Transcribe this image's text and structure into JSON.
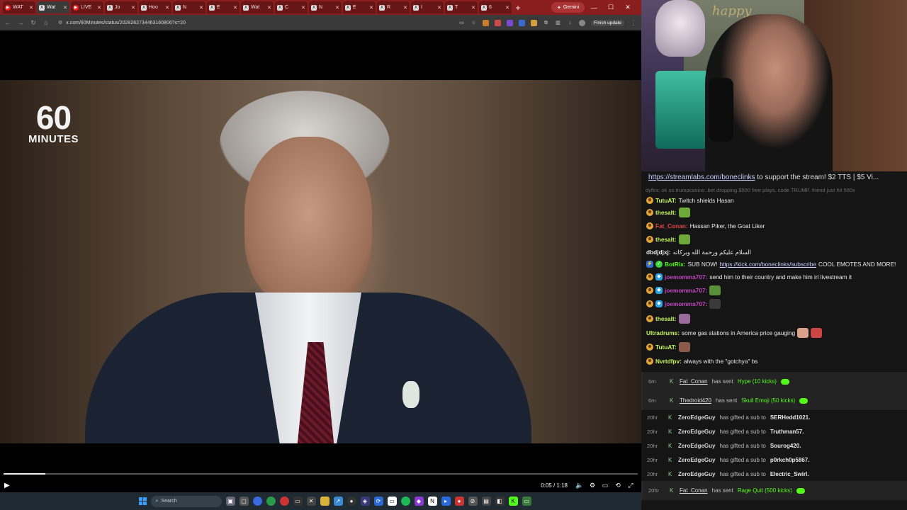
{
  "browser": {
    "tabs": [
      {
        "label": "WAT",
        "icon": "youtube-icon",
        "active": false
      },
      {
        "label": "Wat",
        "icon": "x-icon",
        "active": true
      },
      {
        "label": "LIVE",
        "icon": "youtube-icon",
        "active": false
      },
      {
        "label": "Jo",
        "icon": "x-icon",
        "active": false
      },
      {
        "label": "Hoo",
        "icon": "x-icon",
        "active": false
      },
      {
        "label": "N",
        "icon": "x-icon",
        "active": false
      },
      {
        "label": "E",
        "icon": "x-icon",
        "active": false
      },
      {
        "label": "Wat",
        "icon": "x-icon",
        "active": false
      },
      {
        "label": "C",
        "icon": "x-icon",
        "active": false
      },
      {
        "label": "N",
        "icon": "x-icon",
        "active": false
      },
      {
        "label": "E",
        "icon": "x-icon",
        "active": false
      },
      {
        "label": "R",
        "icon": "x-icon",
        "active": false
      },
      {
        "label": "I",
        "icon": "x-icon",
        "active": false
      },
      {
        "label": "T",
        "icon": "x-icon",
        "active": false
      },
      {
        "label": "6",
        "icon": "x-icon",
        "active": false
      }
    ],
    "gemini_label": "Gemini",
    "url": "x.com/60Minutes/status/2028262734463160806?s=20",
    "finish_update": "Finish update"
  },
  "video": {
    "logo_number": "60",
    "logo_word": "MINUTES",
    "time": "0:05 / 1:18",
    "progress": 0.066
  },
  "taskbar": {
    "search_label": "Search"
  },
  "webcam": {
    "sign_text": "happy"
  },
  "chat": {
    "pinned_link": "https://streamlabs.com/boneclinks",
    "pinned_text": " to support the stream! $2 TTS | $5 Vi...",
    "faded": "dyftrx: ok so trumpcasino .bet dropping $500 free plays, code TRUMP. friend just hit 500x",
    "messages": [
      {
        "badges": [
          "smile"
        ],
        "user": "TutuAT:",
        "color": "#c6f55a",
        "text": "Twitch shields Hasan",
        "emotes": []
      },
      {
        "badges": [
          "smile"
        ],
        "user": "thesalt:",
        "color": "#c6f55a",
        "text": "",
        "emotes": [
          "#6fa83a"
        ]
      },
      {
        "badges": [
          "smile"
        ],
        "user": "Fat_Conan:",
        "color": "#e04646",
        "text": "Hassan Piker, the Goat Liker",
        "emotes": []
      },
      {
        "badges": [
          "smile"
        ],
        "user": "thesalt:",
        "color": "#c6f55a",
        "text": "",
        "emotes": [
          "#6fa83a"
        ]
      },
      {
        "badges": [],
        "user": "dbdjdjxj:",
        "color": "#e8e8e8",
        "text": "السلام عليكم ورحمة الله وبركاته",
        "emotes": []
      },
      {
        "badges": [
          "bot",
          "check"
        ],
        "user": "BotRix:",
        "color": "#53fc18",
        "text": "SUB NOW! ",
        "link": "https://kick.com/boneclinks/subscribe",
        "after": " COOL EMOTES AND MORE!",
        "emotes": []
      },
      {
        "badges": [
          "smile",
          "sub"
        ],
        "user": "joemomma707:",
        "color": "#c243c2",
        "text": "send him to their country and make him irl livestream it",
        "emotes": []
      },
      {
        "badges": [
          "smile",
          "sub"
        ],
        "user": "joemomma707:",
        "color": "#c243c2",
        "text": "",
        "emotes": [
          "#5a8f3a"
        ]
      },
      {
        "badges": [
          "smile",
          "sub"
        ],
        "user": "joemomma707:",
        "color": "#c243c2",
        "text": "",
        "emotes": [
          "#3a3a3a"
        ]
      },
      {
        "badges": [
          "smile"
        ],
        "user": "thesalt:",
        "color": "#c6f55a",
        "text": "",
        "emotes": [
          "#9a6a9a"
        ]
      },
      {
        "badges": [],
        "user": "Ultradrums:",
        "color": "#c6f55a",
        "text": "some gas stations in America price gauging",
        "emotes": [
          "#d9a08a",
          "#c44"
        ]
      },
      {
        "badges": [
          "smile"
        ],
        "user": "TutuAT:",
        "color": "#c6f55a",
        "text": "",
        "emotes": [
          "#8a5a4a"
        ]
      },
      {
        "badges": [
          "smile"
        ],
        "user": "Nvrtdfpv:",
        "color": "#c6f55a",
        "text": "always with the \"gotchya\" bs",
        "emotes": []
      }
    ],
    "events": [
      {
        "time": "6m",
        "user": "Fat_Conan",
        "verb": "has sent",
        "gift": "Hype (10 kicks)",
        "type": "kicks"
      },
      {
        "time": "6m",
        "user": "Thedroid420",
        "verb": "has sent",
        "gift": "Skull Emoji (50 kicks)",
        "type": "kicks"
      },
      {
        "time": "20hr",
        "user": "ZeroEdgeGuy",
        "verb": "has gifted a sub to",
        "target": "SERHedd1021.",
        "type": "sub"
      },
      {
        "time": "20hr",
        "user": "ZeroEdgeGuy",
        "verb": "has gifted a sub to",
        "target": "Truthman57.",
        "type": "sub"
      },
      {
        "time": "20hr",
        "user": "ZeroEdgeGuy",
        "verb": "has gifted a sub to",
        "target": "Sourog420.",
        "type": "sub"
      },
      {
        "time": "20hr",
        "user": "ZeroEdgeGuy",
        "verb": "has gifted a sub to",
        "target": "p0rkch0p5867.",
        "type": "sub"
      },
      {
        "time": "20hr",
        "user": "ZeroEdgeGuy",
        "verb": "has gifted a sub to",
        "target": "Electric_Swirl.",
        "type": "sub"
      },
      {
        "time": "20hr",
        "user": "Fat_Conan",
        "verb": "has sent",
        "gift": "Rage Quit (500 kicks)",
        "type": "kicks"
      }
    ]
  }
}
